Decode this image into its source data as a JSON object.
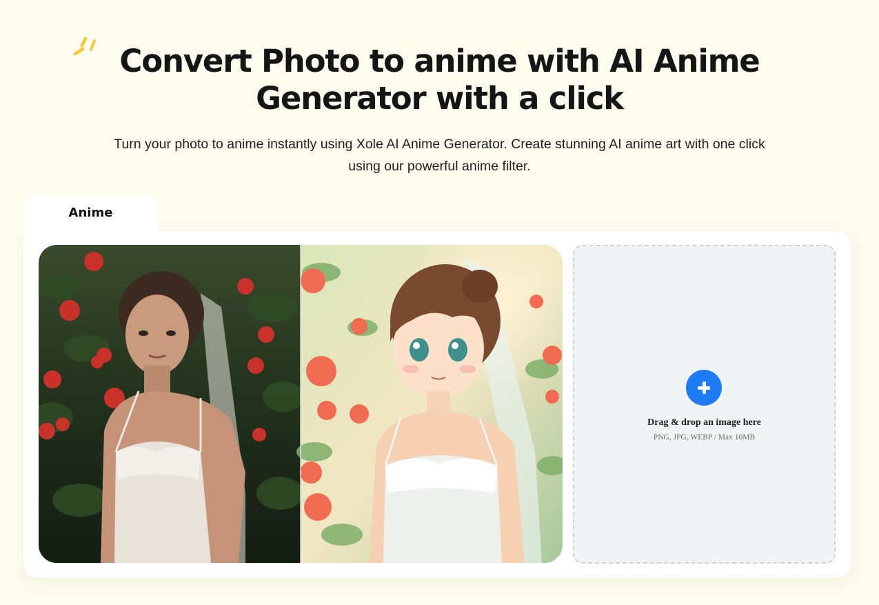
{
  "hero": {
    "title_line1": "Convert Photo to anime with AI Anime",
    "title_line2": "Generator with a click",
    "subtitle_line1": "Turn your photo to anime instantly using Xole AI Anime Generator. Create stunning AI anime art with one click",
    "subtitle_line2": "using our powerful anime filter.",
    "decoration_icon": "sparkle-icon",
    "accent_color": "#f5c842"
  },
  "tabs": [
    {
      "label": "Anime",
      "active": true
    }
  ],
  "comparison": {
    "before_image": "bride-photo",
    "after_image": "anime-bride-illustration"
  },
  "upload": {
    "icon": "plus-circle-icon",
    "title": "Drag & drop an image here",
    "hint": "PNG, JPG, WEBP / Max 10MB",
    "button_color": "#1f7bf2"
  },
  "colors": {
    "page_background": "#fefcef",
    "card_background": "#ffffff",
    "dropzone_background": "#f2f3f5"
  }
}
